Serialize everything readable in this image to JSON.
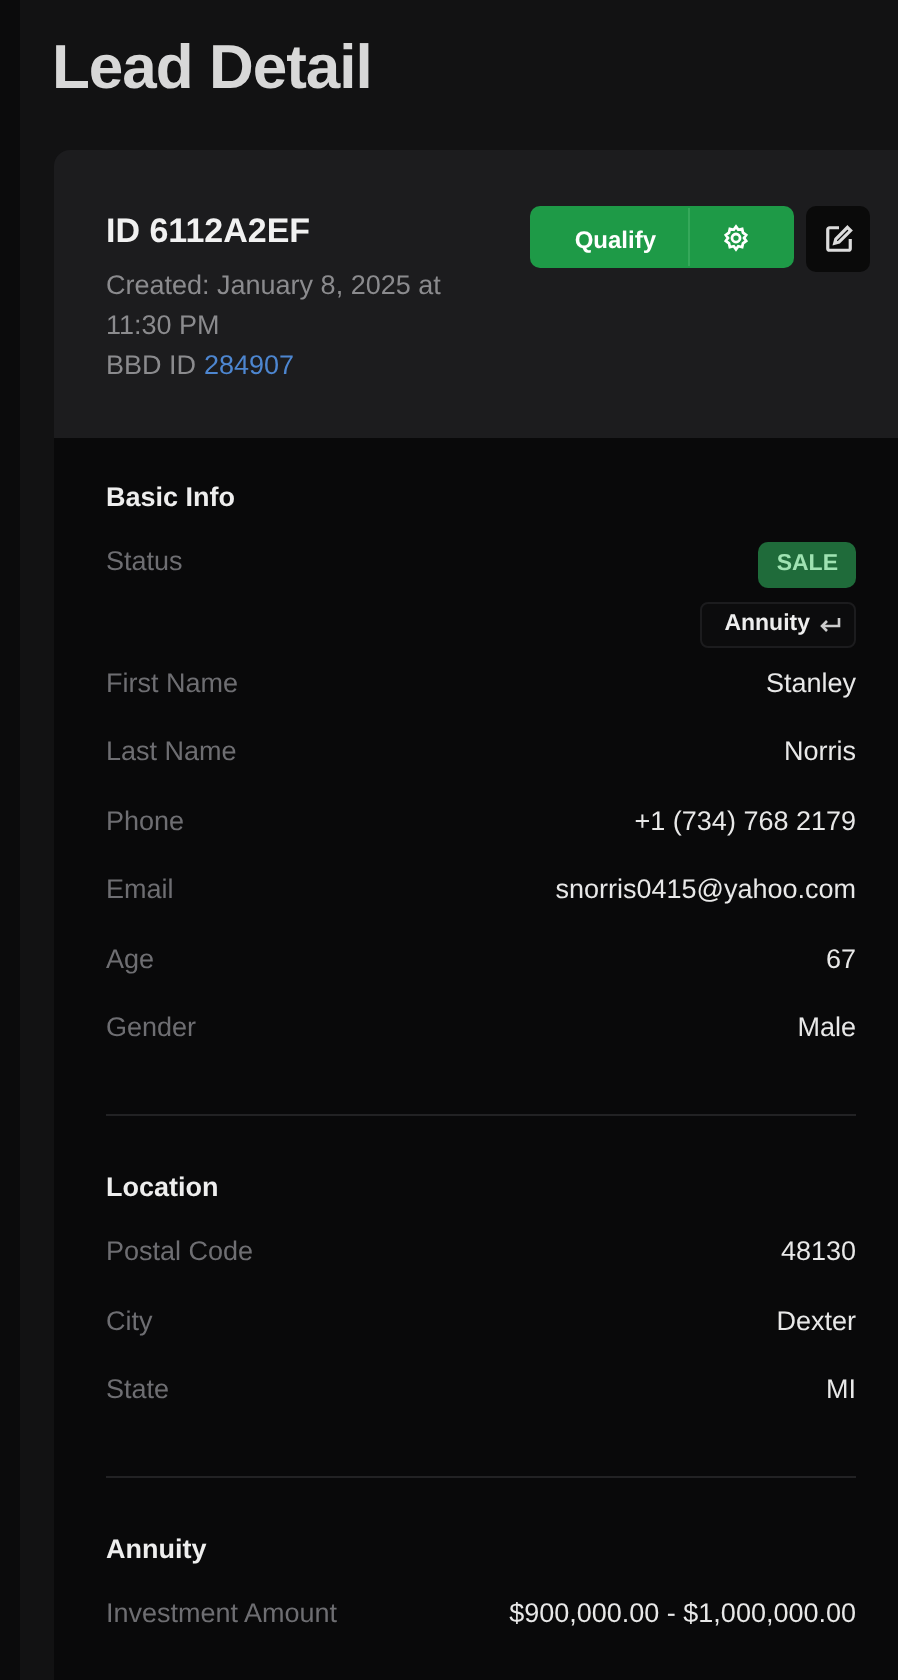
{
  "page_title": "Lead Detail",
  "lead": {
    "id": "ID 6112A2EF",
    "created": "Created: January 8, 2025 at 11:30 PM",
    "bbd_label": "BBD ID",
    "bbd_id": "284907",
    "qualify_button": "Qualify"
  },
  "sections": [
    {
      "title": "Basic Info",
      "rows": [
        {
          "kind": "status",
          "label": "Status",
          "badge": "SALE",
          "tag": "Annuity"
        },
        {
          "kind": "text",
          "label": "First Name",
          "value": "Stanley"
        },
        {
          "kind": "text",
          "label": "Last Name",
          "value": "Norris"
        },
        {
          "kind": "text",
          "label": "Phone",
          "value": "+1 (734) 768 2179"
        },
        {
          "kind": "text",
          "label": "Email",
          "value": "snorris0415@yahoo.com"
        },
        {
          "kind": "text",
          "label": "Age",
          "value": "67"
        },
        {
          "kind": "text",
          "label": "Gender",
          "value": "Male"
        }
      ]
    },
    {
      "title": "Location",
      "rows": [
        {
          "kind": "text",
          "label": "Postal Code",
          "value": "48130"
        },
        {
          "kind": "text",
          "label": "City",
          "value": "Dexter"
        },
        {
          "kind": "text",
          "label": "State",
          "value": "MI"
        }
      ]
    },
    {
      "title": "Annuity",
      "rows": [
        {
          "kind": "text",
          "label": "Investment Amount",
          "value": "$900,000.00 - $1,000,000.00"
        }
      ]
    }
  ]
}
